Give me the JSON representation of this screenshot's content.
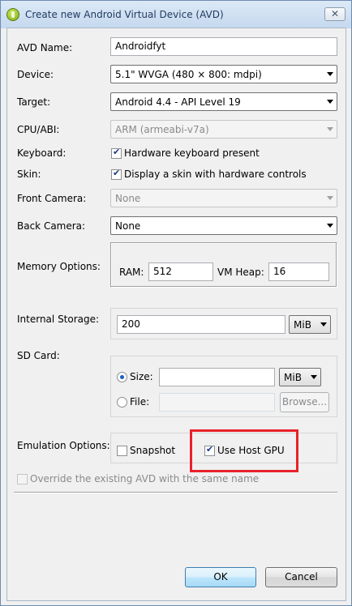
{
  "window": {
    "title": "Create new Android Virtual Device (AVD)",
    "close_label": "✕"
  },
  "avd_name": {
    "label": "AVD Name:",
    "value": "Androidfyt"
  },
  "device": {
    "label": "Device:",
    "value": "5.1\" WVGA (480 × 800: mdpi)"
  },
  "target": {
    "label": "Target:",
    "value": "Android 4.4 - API Level 19"
  },
  "cpu_abi": {
    "label": "CPU/ABI:",
    "value": "ARM (armeabi-v7a)"
  },
  "keyboard": {
    "label": "Keyboard:",
    "checkbox_label": "Hardware keyboard present",
    "checked": true
  },
  "skin": {
    "label": "Skin:",
    "checkbox_label": "Display a skin with hardware controls",
    "checked": true
  },
  "front_camera": {
    "label": "Front Camera:",
    "value": "None"
  },
  "back_camera": {
    "label": "Back Camera:",
    "value": "None"
  },
  "memory": {
    "label": "Memory Options:",
    "ram_label": "RAM:",
    "ram_value": "512",
    "vm_heap_label": "VM Heap:",
    "vm_heap_value": "16"
  },
  "internal_storage": {
    "label": "Internal Storage:",
    "value": "200",
    "unit": "MiB"
  },
  "sd_card": {
    "label": "SD Card:",
    "size_label": "Size:",
    "size_value": "",
    "size_unit": "MiB",
    "size_selected": true,
    "file_label": "File:",
    "file_value": "",
    "browse_label": "Browse..."
  },
  "emulation": {
    "label": "Emulation Options:",
    "snapshot_label": "Snapshot",
    "snapshot_checked": false,
    "host_gpu_label": "Use Host GPU",
    "host_gpu_checked": true
  },
  "override": {
    "label": "Override the existing AVD with the same name",
    "checked": false
  },
  "buttons": {
    "ok": "OK",
    "cancel": "Cancel"
  },
  "colors": {
    "highlight": "#e8212b",
    "title_bar": "#c5d8ee",
    "default_button": "#bee6fd"
  }
}
